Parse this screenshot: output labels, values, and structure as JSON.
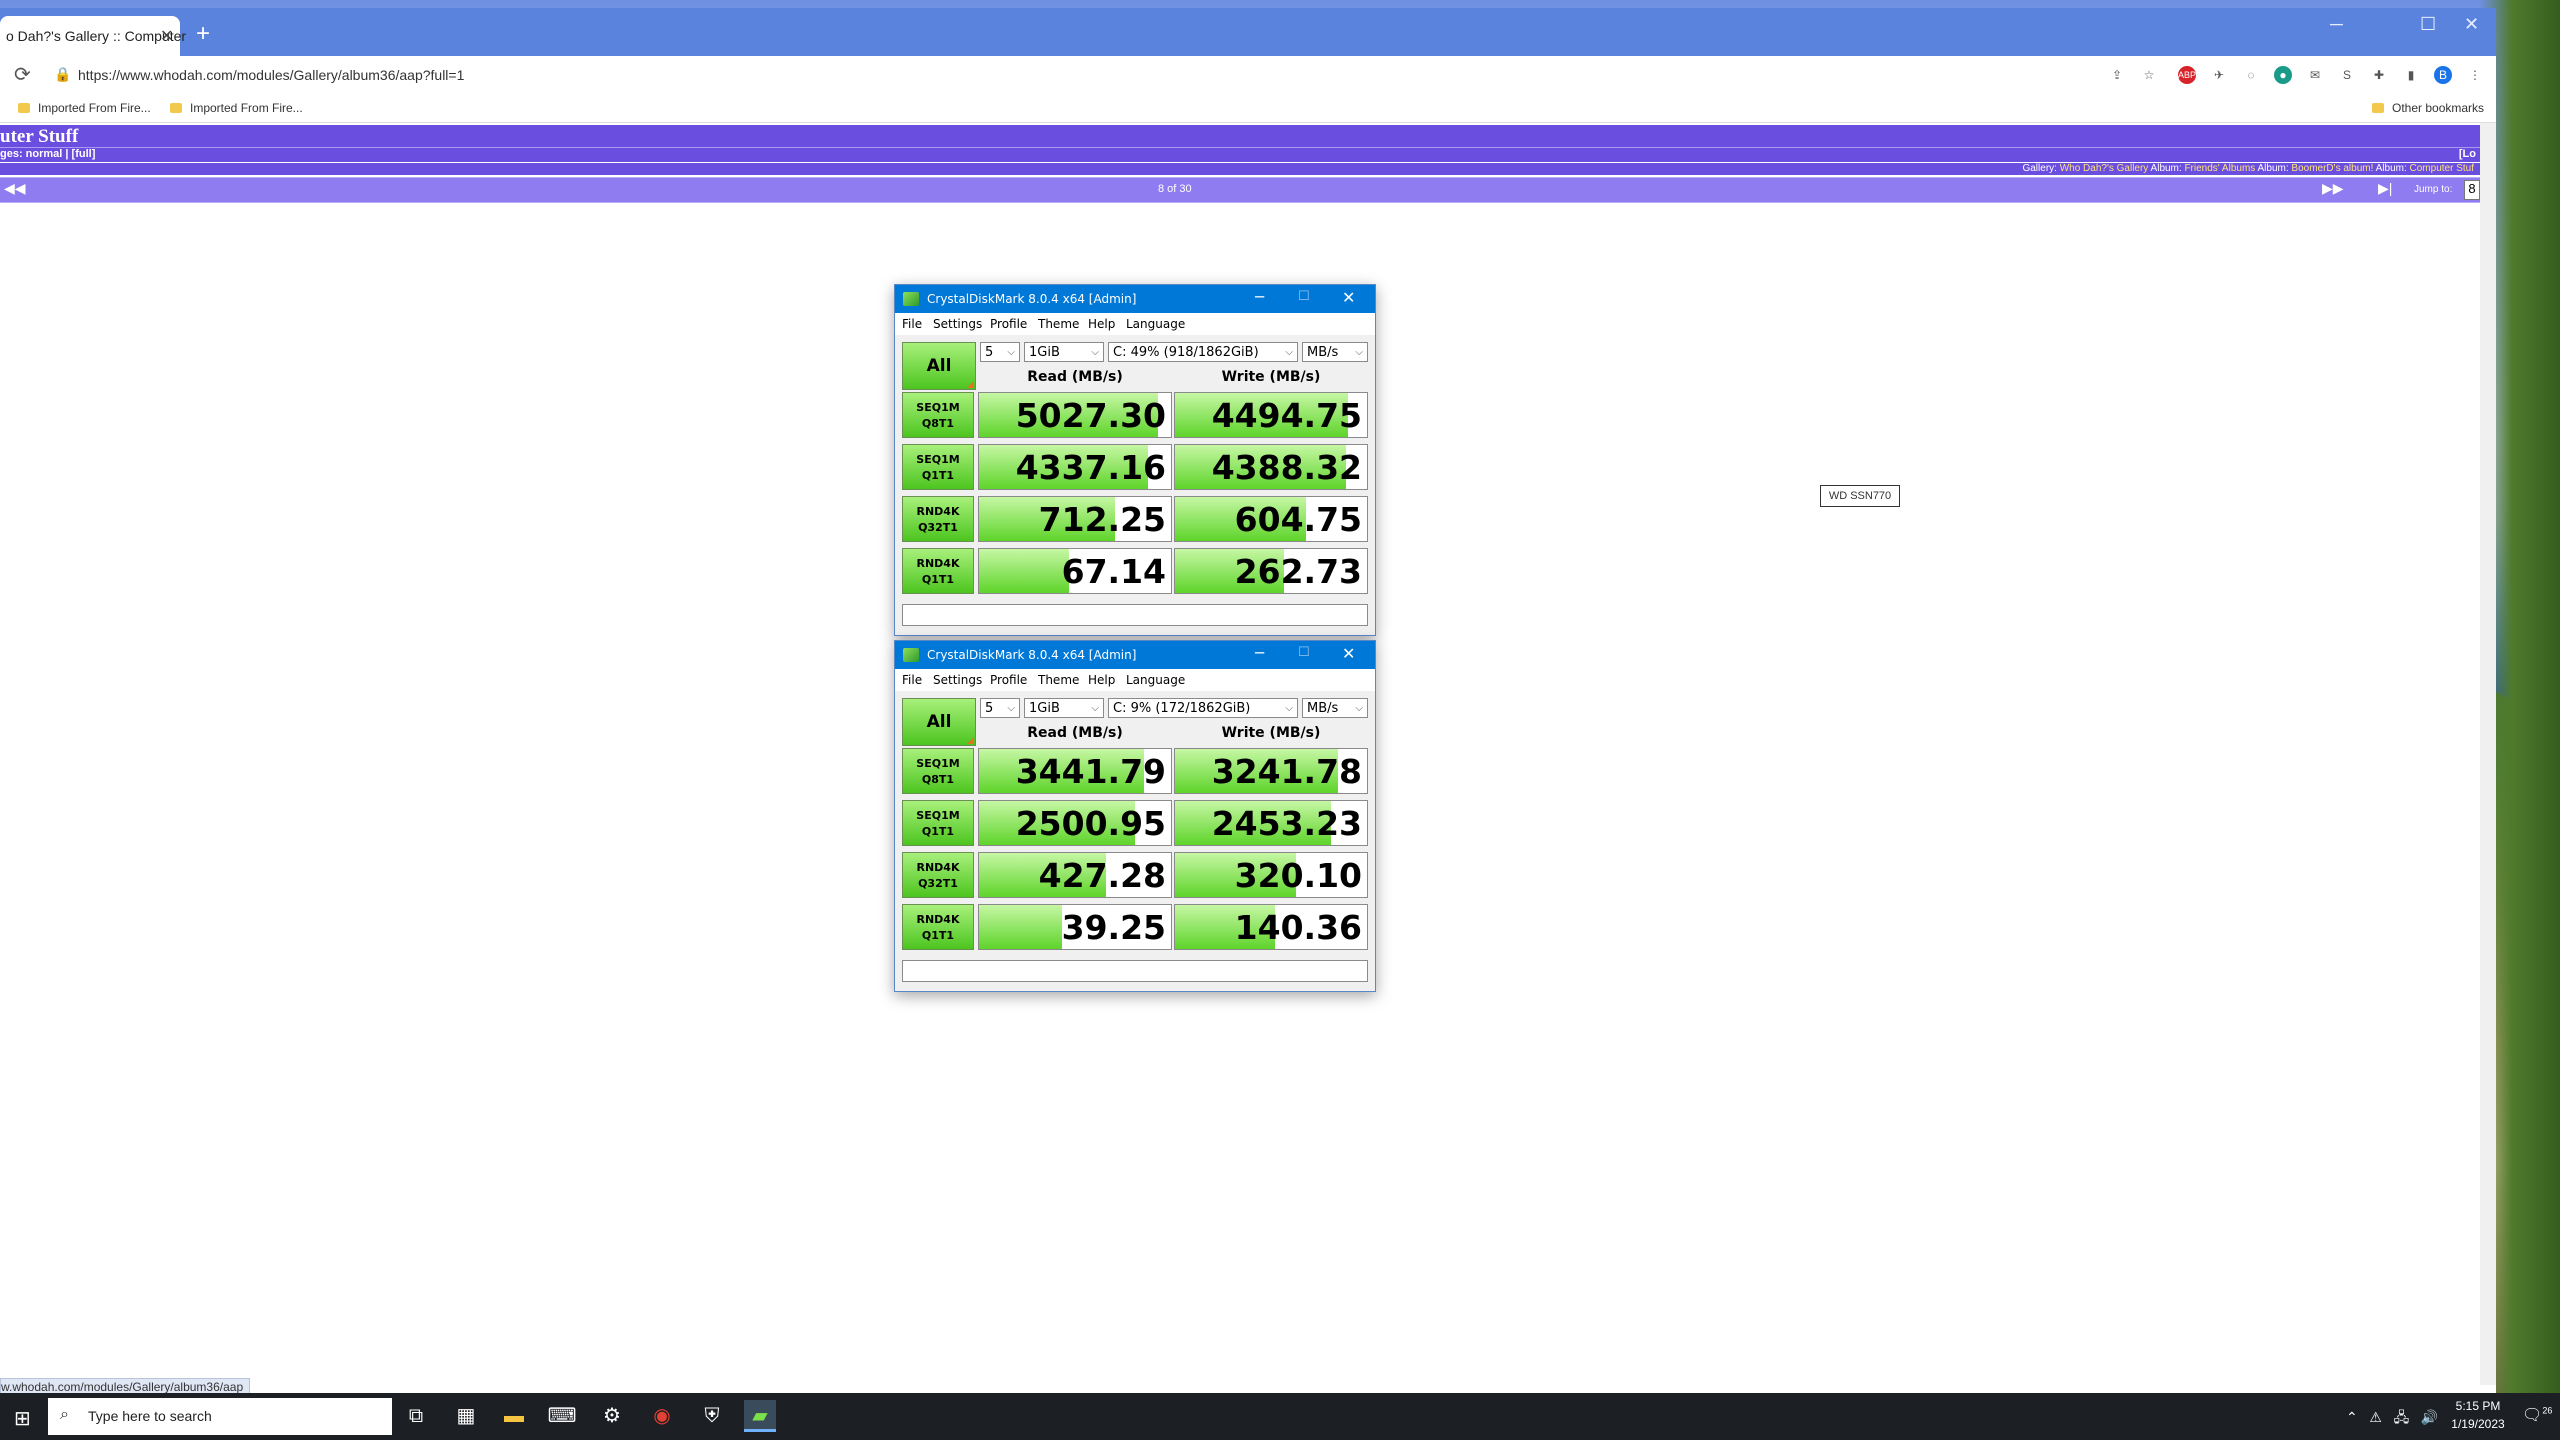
{
  "browser": {
    "tab_title": "o Dah?'s Gallery :: Computer",
    "tab_close": "✕",
    "new_tab": "+",
    "window_controls": [
      "─",
      "☐",
      "✕"
    ],
    "url": "https://www.whodah.com/modules/Gallery/album36/aap?full=1",
    "bookmarks": [
      "Imported From Fire...",
      "Imported From Fire...",
      "Other bookmarks"
    ],
    "profile_initial": "B",
    "status_url": "w.whodah.com/modules/Gallery/album36/aap"
  },
  "gallery": {
    "title": "uter Stuff",
    "sizes": "ges: normal | [full]",
    "right_label": "[Lo",
    "breadcrumb": {
      "gallery_label": "Gallery:",
      "gallery": "Who Dah?'s Gallery",
      "album1_label": "Album:",
      "album1": "Friends' Albums",
      "album2_label": "Album:",
      "album2": "BoomerD's album!",
      "album3_label": "Album:",
      "album3": "Computer Stuf"
    },
    "nav": {
      "prev": "◀◀",
      "count": "8 of 30",
      "next": "▶▶",
      "last": "▶|",
      "jump_label": "Jump to:",
      "jump_value": "8"
    }
  },
  "overlay_label": "WD SSN770",
  "cdm_windows": [
    {
      "title": "CrystalDiskMark 8.0.4 x64 [Admin]",
      "menu": [
        "File",
        "Settings",
        "Profile",
        "Theme",
        "Help",
        "Language"
      ],
      "all_label": "All",
      "count": "5",
      "size": "1GiB",
      "drive": "C: 49% (918/1862GiB)",
      "unit": "MB/s",
      "read_header": "Read (MB/s)",
      "write_header": "Write (MB/s)",
      "rows": [
        {
          "label1": "SEQ1M",
          "label2": "Q8T1",
          "read": "5027.30",
          "write": "4494.75",
          "read_fill": 0.93,
          "write_fill": 0.9
        },
        {
          "label1": "SEQ1M",
          "label2": "Q1T1",
          "read": "4337.16",
          "write": "4388.32",
          "read_fill": 0.88,
          "write_fill": 0.89
        },
        {
          "label1": "RND4K",
          "label2": "Q32T1",
          "read": "712.25",
          "write": "604.75",
          "read_fill": 0.71,
          "write_fill": 0.68
        },
        {
          "label1": "RND4K",
          "label2": "Q1T1",
          "read": "67.14",
          "write": "262.73",
          "read_fill": 0.47,
          "write_fill": 0.57
        }
      ]
    },
    {
      "title": "CrystalDiskMark 8.0.4 x64 [Admin]",
      "menu": [
        "File",
        "Settings",
        "Profile",
        "Theme",
        "Help",
        "Language"
      ],
      "all_label": "All",
      "count": "5",
      "size": "1GiB",
      "drive": "C: 9% (172/1862GiB)",
      "unit": "MB/s",
      "read_header": "Read (MB/s)",
      "write_header": "Write (MB/s)",
      "rows": [
        {
          "label1": "SEQ1M",
          "label2": "Q8T1",
          "read": "3441.79",
          "write": "3241.78",
          "read_fill": 0.86,
          "write_fill": 0.85
        },
        {
          "label1": "SEQ1M",
          "label2": "Q1T1",
          "read": "2500.95",
          "write": "2453.23",
          "read_fill": 0.81,
          "write_fill": 0.81
        },
        {
          "label1": "RND4K",
          "label2": "Q32T1",
          "read": "427.28",
          "write": "320.10",
          "read_fill": 0.66,
          "write_fill": 0.63
        },
        {
          "label1": "RND4K",
          "label2": "Q1T1",
          "read": "39.25",
          "write": "140.36",
          "read_fill": 0.43,
          "write_fill": 0.52
        }
      ]
    }
  ],
  "taskbar": {
    "search_placeholder": "Type here to search",
    "time": "5:15 PM",
    "date": "1/19/2023",
    "notification_count": "26"
  }
}
